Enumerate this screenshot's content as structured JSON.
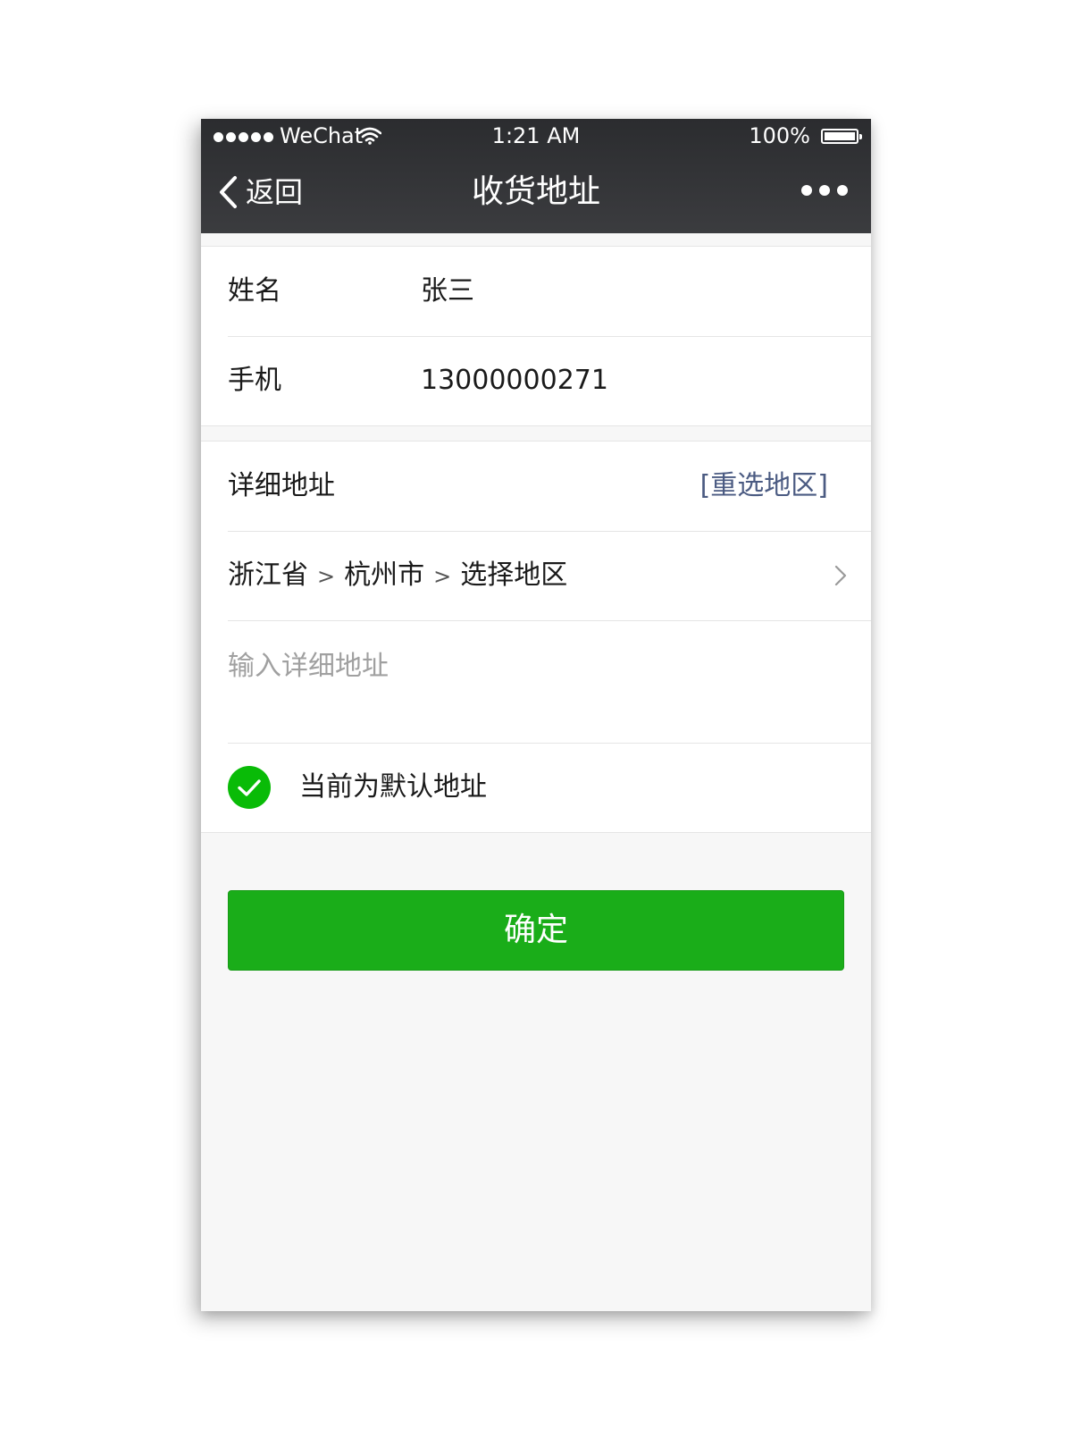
{
  "status_bar": {
    "carrier": "WeChat",
    "time": "1:21 AM",
    "battery": "100%"
  },
  "nav": {
    "back_label": "返回",
    "title": "收货地址",
    "more_icon": "more-dots-icon"
  },
  "contact": {
    "name_label": "姓名",
    "name_value": "张三",
    "phone_label": "手机",
    "phone_value": "13000000271"
  },
  "address": {
    "detail_label": "详细地址",
    "reselect_label": "[重选地区]",
    "province": "浙江省",
    "city": "杭州市",
    "district": "选择地区",
    "separator": ">",
    "detail_placeholder": "输入详细地址",
    "detail_value": "",
    "default_label": "当前为默认地址",
    "is_default": true
  },
  "confirm_label": "确定",
  "colors": {
    "nav_bg": "#2e2f32",
    "accent_green": "#1aad19",
    "link_blue": "#4b5b82",
    "page_bg": "#f7f7f7"
  }
}
